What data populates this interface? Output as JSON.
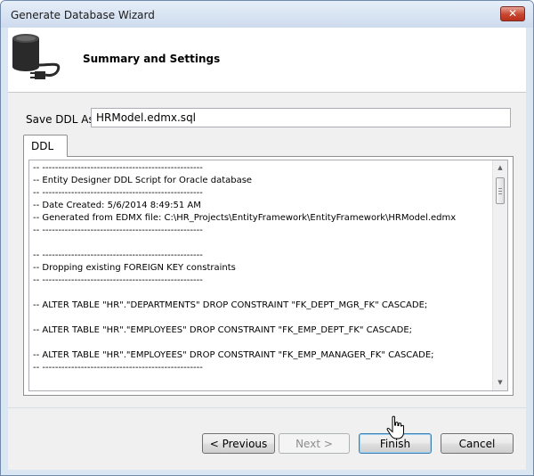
{
  "window": {
    "title": "Generate Database Wizard",
    "close_glyph": "✕"
  },
  "header": {
    "title": "Summary and Settings",
    "icon": "database-plug-icon"
  },
  "save_ddl": {
    "label": "Save DDL As:",
    "value": "HRModel.edmx.sql"
  },
  "tabs": [
    {
      "label": "DDL",
      "selected": true
    }
  ],
  "ddl_lines": [
    "-- --------------------------------------------------",
    "-- Entity Designer DDL Script for Oracle database",
    "-- --------------------------------------------------",
    "-- Date Created: 5/6/2014 8:49:51 AM",
    "-- Generated from EDMX file: C:\\HR_Projects\\EntityFramework\\EntityFramework\\HRModel.edmx",
    "-- --------------------------------------------------",
    "",
    "-- --------------------------------------------------",
    "-- Dropping existing FOREIGN KEY constraints",
    "-- --------------------------------------------------",
    "",
    "-- ALTER TABLE \"HR\".\"DEPARTMENTS\" DROP CONSTRAINT \"FK_DEPT_MGR_FK\" CASCADE;",
    "",
    "-- ALTER TABLE \"HR\".\"EMPLOYEES\" DROP CONSTRAINT \"FK_EMP_DEPT_FK\" CASCADE;",
    "",
    "-- ALTER TABLE \"HR\".\"EMPLOYEES\" DROP CONSTRAINT \"FK_EMP_MANAGER_FK\" CASCADE;",
    "-- --------------------------------------------------"
  ],
  "scrollbar": {
    "up_glyph": "▲",
    "down_glyph": "▼"
  },
  "buttons": {
    "previous": "< Previous",
    "next": "Next >",
    "finish": "Finish",
    "cancel": "Cancel"
  },
  "colors": {
    "close": "#c8452f",
    "default_button_border": "#3c7fb1",
    "title_bar": "#cddbee"
  }
}
